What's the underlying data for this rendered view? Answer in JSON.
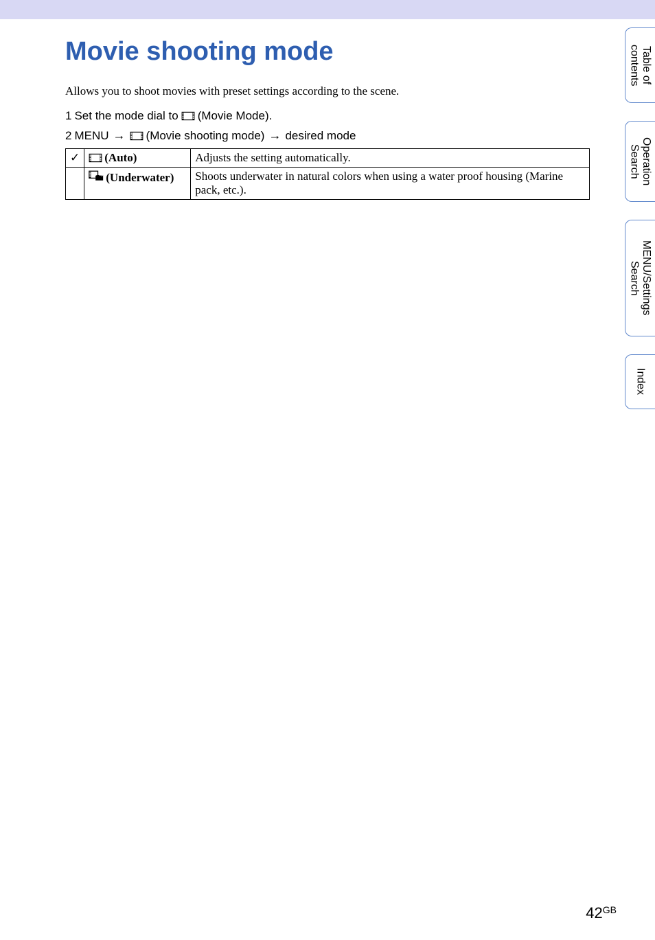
{
  "title": "Movie shooting mode",
  "intro": "Allows you to shoot movies with preset settings according to the scene.",
  "steps": {
    "s1_num": "1",
    "s1_prefix": "Set the mode dial to",
    "s1_suffix": "(Movie Mode).",
    "s2_num": "2",
    "s2_prefix": "MENU",
    "s2_mid": "(Movie shooting mode)",
    "s2_suffix": "desired mode"
  },
  "table": {
    "rows": [
      {
        "check": "✓",
        "label": "(Auto)",
        "desc": "Adjusts the setting automatically."
      },
      {
        "check": "",
        "label": "(Underwater)",
        "desc": "Shoots underwater in natural colors when using a water proof housing (Marine pack, etc.)."
      }
    ]
  },
  "sidetabs": {
    "t1": "Table of\ncontents",
    "t2": "Operation\nSearch",
    "t3": "MENU/Settings\nSearch",
    "t4": "Index"
  },
  "footer": {
    "page": "42",
    "suffix": "GB"
  }
}
